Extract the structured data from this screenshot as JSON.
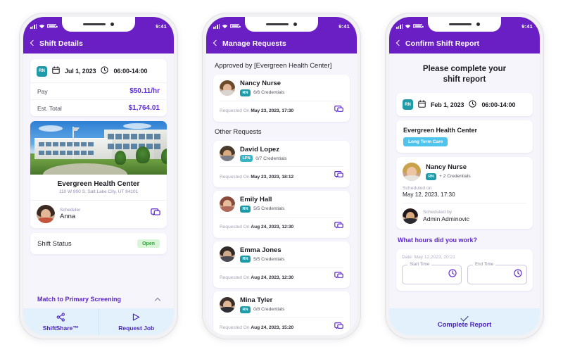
{
  "status_bar": {
    "time": "9:41"
  },
  "phone1": {
    "header": {
      "title": "Shift Details",
      "back_icon": "chevron-left-icon"
    },
    "shift": {
      "credential_badge": "RN",
      "date": "Jul 1, 2023",
      "time_range": "06:00-14:00",
      "pay_label": "Pay",
      "pay_value": "$50.11/hr",
      "est_total_label": "Est. Total",
      "est_total_value": "$1,764.01"
    },
    "facility": {
      "name": "Evergreen Health Center",
      "address": "110 W 900 S, Salt Lake City, UT 84101",
      "scheduler_label": "Scheduler",
      "scheduler_name": "Anna",
      "chat_icon": "chat-bubble-icon"
    },
    "status": {
      "label": "Shift Status",
      "value": "Open"
    },
    "match": {
      "label": "Match to Primary Screening",
      "chevron": "chevron-up-icon"
    },
    "tabs": [
      {
        "label": "ShiftShare™",
        "icon": "share-icon"
      },
      {
        "label": "Request Job",
        "icon": "send-icon"
      }
    ]
  },
  "phone2": {
    "header": {
      "title": "Manage Requests",
      "back_icon": "chevron-left-icon"
    },
    "approved_section_title": "Approved by [Evergreen Health Center]",
    "other_section_title": "Other Requests",
    "requested_on_label": "Requested On",
    "approved": [
      {
        "name": "Nancy Nurse",
        "badge": "RN",
        "badge_type": "rn",
        "credentials": "6/6 Credentials",
        "requested_on": "May 23, 2023, 17:30",
        "action_icon": "chat-bubble-icon"
      }
    ],
    "others": [
      {
        "name": "David Lopez",
        "badge": "LPN",
        "badge_type": "lpn",
        "credentials": "0/7 Credentials",
        "requested_on": "May 23, 2023, 18:12",
        "action_icon": "chat-bubble-icon"
      },
      {
        "name": "Emily Hall",
        "badge": "RN",
        "badge_type": "rn",
        "credentials": "5/5 Credentials",
        "requested_on": "Aug 24, 2023, 12:30",
        "action_icon": "chat-bubble-icon"
      },
      {
        "name": "Emma Jones",
        "badge": "RN",
        "badge_type": "rn",
        "credentials": "5/5 Credentials",
        "requested_on": "Aug 24, 2023, 12:30",
        "action_icon": "chat-bubble-icon"
      },
      {
        "name": "Mina Tyler",
        "badge": "RN",
        "badge_type": "rn",
        "credentials": "0/8 Credentials",
        "requested_on": "Aug 24, 2023, 15:20",
        "action_icon": "chat-bubble-icon"
      }
    ]
  },
  "phone3": {
    "header": {
      "title": "Confirm Shift Report",
      "back_icon": "chevron-left-icon"
    },
    "lead_line1": "Please complete your",
    "lead_line2": "shift report",
    "shift": {
      "credential_badge": "RN",
      "date": "Feb 1, 2023",
      "time_range": "06:00-14:00"
    },
    "facility": {
      "name": "Evergreen Health Center",
      "tag": "Long Term Care"
    },
    "worker": {
      "name": "Nancy Nurse",
      "badge": "RN",
      "credentials": "+ 2 Credentials",
      "scheduled_on_label": "Scheduled on",
      "scheduled_on_value": "May 12, 2023, 17:30",
      "scheduled_by_label": "Scheduled by",
      "scheduled_by_value": "Admin Adminovic"
    },
    "hours": {
      "question": "What hours did you work?",
      "date_line": "Date: May 12,2023, 20:21",
      "start_label": "Start Time",
      "start_value": "",
      "end_label": "End Time",
      "end_value": "",
      "clock_icon": "clock-icon"
    },
    "complete": {
      "label": "Complete Report",
      "icon": "check-icon"
    }
  },
  "colors": {
    "purple_header": "#6a1fc4",
    "purple_text": "#5b27c9",
    "teal_badge": "#1f9aa8",
    "cyan_tag": "#4ec3ec",
    "green_pill_bg": "#d8f5d8",
    "green_pill_text": "#3c9b45",
    "tabbar_bg": "#e2f1fb"
  }
}
